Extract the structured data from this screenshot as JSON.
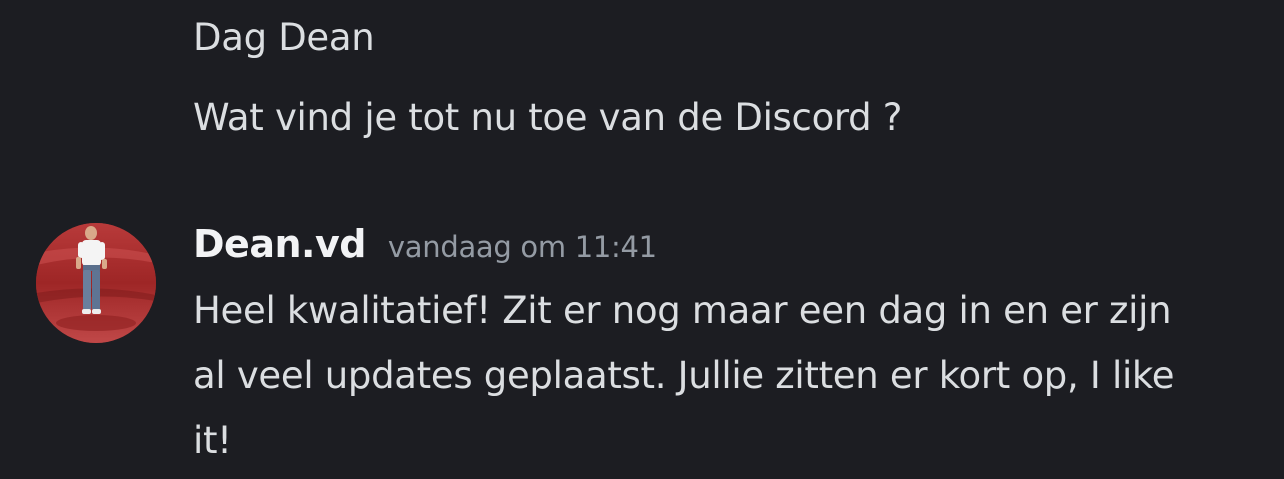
{
  "previous_messages": [
    {
      "text": "Dag Dean"
    },
    {
      "text": "Wat vind je tot nu toe van de Discord ?"
    }
  ],
  "message": {
    "author": "Dean.vd",
    "timestamp": "vandaag om 11:41",
    "text": "Heel kwalitatief! Zit er nog maar een dag in en er zijn al veel updates geplaatst. Jullie zitten er kort op, I like it!"
  },
  "colors": {
    "background": "#1c1d22",
    "message_text": "#dbdee1",
    "username": "#f2f3f5",
    "timestamp": "#949ba4"
  }
}
